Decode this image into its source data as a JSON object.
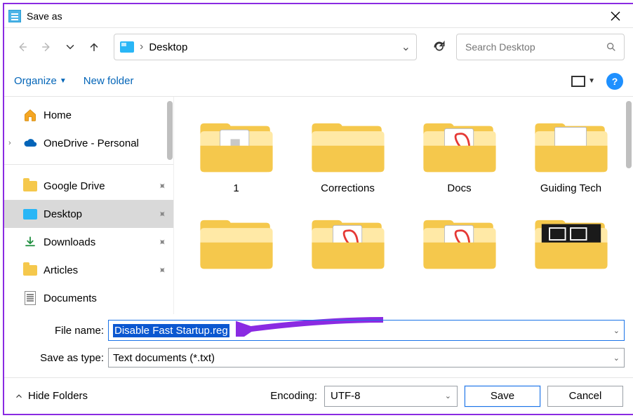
{
  "window": {
    "title": "Save as"
  },
  "nav": {
    "location": "Desktop",
    "search_placeholder": "Search Desktop"
  },
  "toolbar": {
    "organize": "Organize",
    "new_folder": "New folder"
  },
  "sidebar": {
    "top": [
      {
        "label": "Home",
        "type": "home"
      },
      {
        "label": "OneDrive - Personal",
        "type": "cloud",
        "expandable": true
      }
    ],
    "quick": [
      {
        "label": "Google Drive",
        "type": "folder",
        "pinned": true
      },
      {
        "label": "Desktop",
        "type": "desktop",
        "pinned": true,
        "selected": true
      },
      {
        "label": "Downloads",
        "type": "download",
        "pinned": true
      },
      {
        "label": "Articles",
        "type": "folder",
        "pinned": true
      },
      {
        "label": "Documents",
        "type": "doc",
        "pinned": false
      }
    ]
  },
  "files": [
    {
      "label": "1",
      "kind": "folder-file"
    },
    {
      "label": "Corrections",
      "kind": "folder"
    },
    {
      "label": "Docs",
      "kind": "folder-pdf"
    },
    {
      "label": "Guiding Tech",
      "kind": "folder-page"
    },
    {
      "label": "",
      "kind": "folder"
    },
    {
      "label": "",
      "kind": "folder-pdf"
    },
    {
      "label": "",
      "kind": "folder-pdf"
    },
    {
      "label": "",
      "kind": "folder-dark"
    }
  ],
  "inputs": {
    "filename_label": "File name:",
    "filename_value": "Disable Fast Startup.reg",
    "type_label": "Save as type:",
    "type_value": "Text documents (*.txt)"
  },
  "footer": {
    "hide_folders": "Hide Folders",
    "encoding_label": "Encoding:",
    "encoding_value": "UTF-8",
    "save": "Save",
    "cancel": "Cancel"
  }
}
